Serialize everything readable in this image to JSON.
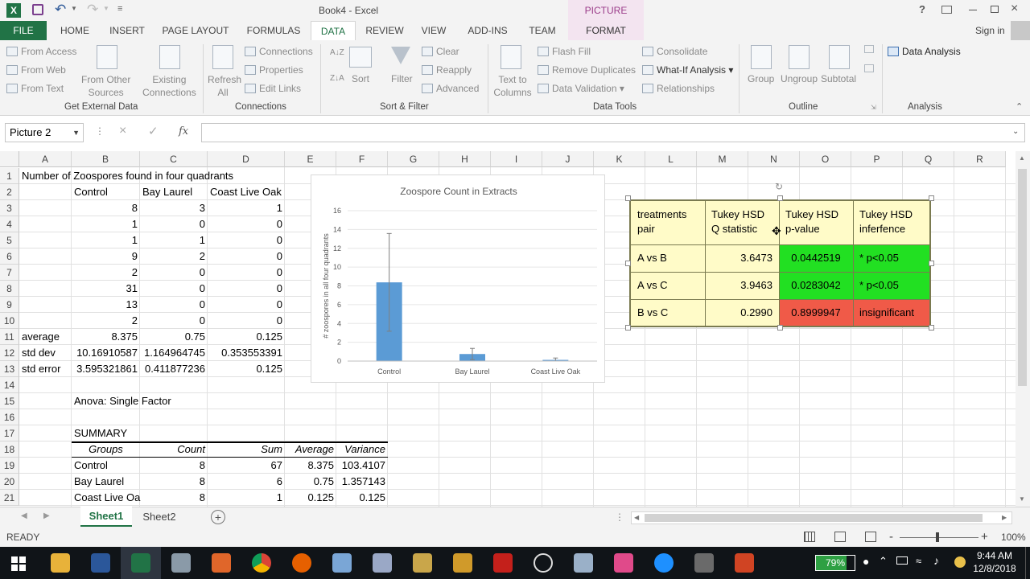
{
  "window": {
    "title": "Book4 - Excel",
    "context_tab_group": "PICTURE TOOLS",
    "help": "?",
    "sign_in": "Sign in"
  },
  "tabs": [
    "FILE",
    "HOME",
    "INSERT",
    "PAGE LAYOUT",
    "FORMULAS",
    "DATA",
    "REVIEW",
    "VIEW",
    "ADD-INS",
    "TEAM",
    "FORMAT"
  ],
  "ribbon": {
    "get_external": {
      "from_access": "From Access",
      "from_web": "From Web",
      "from_text": "From Text",
      "from_other": "From Other",
      "sources": "Sources",
      "existing": "Existing",
      "connections_btn": "Connections",
      "label": "Get External Data"
    },
    "connections": {
      "refresh": "Refresh",
      "all": "All",
      "connections": "Connections",
      "properties": "Properties",
      "edit_links": "Edit Links",
      "label": "Connections"
    },
    "sort_filter": {
      "sort": "Sort",
      "filter": "Filter",
      "clear": "Clear",
      "reapply": "Reapply",
      "advanced": "Advanced",
      "label": "Sort & Filter"
    },
    "data_tools": {
      "text_to": "Text to",
      "columns": "Columns",
      "flash_fill": "Flash Fill",
      "remove_duplicates": "Remove Duplicates",
      "data_validation": "Data Validation",
      "consolidate": "Consolidate",
      "what_if": "What-If Analysis",
      "relationships": "Relationships",
      "label": "Data Tools"
    },
    "outline": {
      "group": "Group",
      "ungroup": "Ungroup",
      "subtotal": "Subtotal",
      "label": "Outline"
    },
    "analysis": {
      "data_analysis": "Data Analysis",
      "label": "Analysis"
    }
  },
  "formula_bar": {
    "name_box": "Picture 2",
    "fx": "fx",
    "formula": ""
  },
  "columns": [
    "A",
    "B",
    "C",
    "D",
    "E",
    "F",
    "G",
    "H",
    "I",
    "J",
    "K",
    "L",
    "M",
    "N",
    "O",
    "P",
    "Q",
    "R"
  ],
  "rows": [
    "1",
    "2",
    "3",
    "4",
    "5",
    "6",
    "7",
    "8",
    "9",
    "10",
    "11",
    "12",
    "13",
    "14",
    "15",
    "16",
    "17",
    "18",
    "19",
    "20",
    "21"
  ],
  "cells": {
    "A1": "Number of Zoospores found in four quadrants",
    "B2": "Control",
    "C2": "Bay Laurel",
    "D2": "Coast Live Oak",
    "B3": "8",
    "C3": "3",
    "D3": "1",
    "B4": "1",
    "C4": "0",
    "D4": "0",
    "B5": "1",
    "C5": "1",
    "D5": "0",
    "B6": "9",
    "C6": "2",
    "D6": "0",
    "B7": "2",
    "C7": "0",
    "D7": "0",
    "B8": "31",
    "C8": "0",
    "D8": "0",
    "B9": "13",
    "C9": "0",
    "D9": "0",
    "B10": "2",
    "C10": "0",
    "D10": "0",
    "A11": "average",
    "B11": "8.375",
    "C11": "0.75",
    "D11": "0.125",
    "A12": "std dev",
    "B12": "10.16910587",
    "C12": "1.164964745",
    "D12": "0.353553391",
    "A13": "std error",
    "B13": "3.595321861",
    "C13": "0.411877236",
    "D13": "0.125",
    "B15": "Anova: Single Factor",
    "B17": "SUMMARY",
    "B18": "Groups",
    "C18": "Count",
    "D18": "Sum",
    "E18": "Average",
    "F18": "Variance",
    "B19": "Control",
    "C19": "8",
    "D19": "67",
    "E19": "8.375",
    "F19": "103.4107",
    "B20": "Bay Laurel",
    "C20": "8",
    "D20": "6",
    "E20": "0.75",
    "F20": "1.357143",
    "B21": "Coast Live Oa",
    "C21": "8",
    "D21": "1",
    "E21": "0.125",
    "F21": "0.125"
  },
  "chart_data": {
    "type": "bar",
    "title": "Zoospore Count in Extracts",
    "ylabel": "# zoospores in all four quadrants",
    "categories": [
      "Control",
      "Bay Laurel",
      "Coast Live Oak"
    ],
    "values": [
      8.375,
      0.75,
      0.125
    ],
    "errors": [
      5.2,
      0.6,
      0.2
    ],
    "ylim": [
      0,
      16
    ],
    "yticks": [
      "0",
      "2",
      "4",
      "6",
      "8",
      "10",
      "12",
      "14",
      "16"
    ],
    "bar_color": "#5b9bd5"
  },
  "tukey": {
    "headers": [
      [
        "treatments",
        "pair"
      ],
      [
        "Tukey HSD",
        "Q statistic"
      ],
      [
        "Tukey HSD",
        "p-value"
      ],
      [
        "Tukey HSD",
        "inferfence"
      ]
    ],
    "rows": [
      {
        "pair": "A vs B",
        "q": "3.6473",
        "p": "0.0442519",
        "inf": "* p<0.05",
        "p_color": "#22e022",
        "inf_color": "#22e022"
      },
      {
        "pair": "A vs C",
        "q": "3.9463",
        "p": "0.0283042",
        "inf": "* p<0.05",
        "p_color": "#22e022",
        "inf_color": "#22e022"
      },
      {
        "pair": "B vs C",
        "q": "0.2990",
        "p": "0.8999947",
        "inf": "insignificant",
        "p_color": "#f05a48",
        "inf_color": "#f05a48"
      }
    ]
  },
  "sheets": {
    "tabs": [
      "Sheet1",
      "Sheet2"
    ],
    "active": "Sheet1",
    "add": "+"
  },
  "status": {
    "mode": "READY",
    "zoom": "100%",
    "zoom_minus": "-",
    "zoom_plus": "+"
  },
  "taskbar": {
    "battery": "79%",
    "time": "9:44 AM",
    "date": "12/8/2018"
  }
}
